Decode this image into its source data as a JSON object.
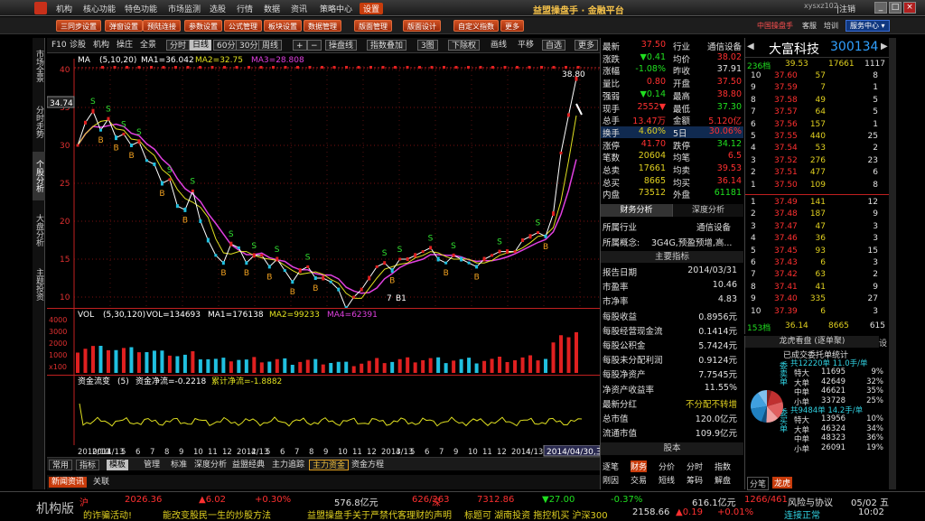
{
  "titlebar": {
    "menus": [
      "机构",
      "核心功能",
      "特色功能",
      "市场监测",
      "选股",
      "行情",
      "数据",
      "资讯",
      "策略中心",
      "设置"
    ],
    "active_menu": "设置",
    "app_title": "益盟操盘手 · 金融平台",
    "user": "xysxz102",
    "exit": "|注销"
  },
  "toolbar2": {
    "buttons": [
      "三同步设置",
      "弹窗设置",
      "预陆连接",
      "参数设置",
      "公式管理",
      "板块设置",
      "数据管理",
      "版面管理",
      "版面设计",
      "自定义指数",
      "更多"
    ],
    "right_links": [
      "中国操盘手",
      "客服",
      "培训"
    ],
    "service_center": "服务中心 ▾"
  },
  "side_tabs": [
    "市场全景",
    "分时走势",
    "个股分析",
    "大盘分析",
    "主题投资"
  ],
  "chart_toolbar": {
    "items": [
      "F10",
      "诊股",
      "机构",
      "操庄",
      "全景",
      "分时",
      "日线",
      "60分",
      "30分",
      "周线",
      "+",
      "−",
      "操盘线",
      "指数叠加",
      "3图",
      "下除权",
      "画线",
      "平移",
      "自选",
      "更多"
    ],
    "selected": "日线"
  },
  "price_chart": {
    "indicator": "MA",
    "params": "(5,10,20)",
    "ma1": "MA1=36.042",
    "ma2": "MA2=32.75",
    "ma3": "MA3=28.808",
    "y_ticks": [
      "40",
      "35",
      "30",
      "25",
      "20",
      "15",
      "10"
    ],
    "marker_high": "38.80",
    "marker_left": "34.74",
    "marker_low": "7",
    "marker_b1": "B1"
  },
  "vol_chart": {
    "title": "VOL",
    "params": "(5,30,120)",
    "vol": "VOL=134693",
    "ma1": "MA1=176138",
    "ma2": "MA2=99233",
    "ma4": "MA4=62391",
    "y_ticks": [
      "4000",
      "3000",
      "2000",
      "1000",
      "x100"
    ]
  },
  "flow_chart": {
    "title": "资金流变",
    "params": "(5)",
    "net": "资金净流=-0.2218",
    "cum": "累计净流=-1.8882"
  },
  "chart_data": {
    "type": "line",
    "xlabel": "",
    "ylabel": "",
    "x_ticks": [
      "2010/10",
      "2011/13",
      "4",
      "5",
      "6",
      "7",
      "8",
      "9",
      "10",
      "11",
      "12",
      "2012/13",
      "4",
      "5",
      "6",
      "7",
      "8",
      "9",
      "10",
      "11",
      "12",
      "2013/13",
      "4",
      "5",
      "6",
      "7",
      "9",
      "10",
      "11",
      "12",
      "2014/13",
      "4"
    ],
    "ylim": [
      10,
      40
    ],
    "series": [
      {
        "values": [
          30,
          33,
          34.5,
          32,
          33.5,
          31,
          31.5,
          30,
          30.5,
          28,
          27.5,
          25,
          25.5,
          22,
          21.5,
          24,
          20,
          17.5,
          15.5,
          14.5,
          17,
          16.5,
          14.5,
          15.5,
          15.5,
          14,
          15,
          13.5,
          12,
          13.5,
          14,
          12.5,
          12.5,
          12,
          11,
          8.5,
          10,
          11,
          12.5,
          14,
          14.5,
          13.5,
          15,
          15,
          15.5,
          16,
          16.5,
          15,
          14.5,
          15.5,
          15,
          14.5,
          14,
          15,
          15.5,
          16,
          16,
          16,
          17.5,
          18,
          18.5,
          18,
          21,
          29,
          34,
          38.8
        ]
      }
    ],
    "current_date": "2014/04/30,三"
  },
  "quote": {
    "rows": [
      [
        "最新",
        "37.50",
        "行业",
        "通信设备"
      ],
      [
        "涨跌",
        "▼0.41",
        "均价",
        "38.02"
      ],
      [
        "涨幅",
        "-1.08%",
        "昨收",
        "37.91"
      ],
      [
        "量比",
        "0.80",
        "开盘",
        "37.50"
      ],
      [
        "强弱",
        "▼0.14",
        "最高",
        "38.80"
      ],
      [
        "现手",
        "2552▼",
        "最低",
        "37.30"
      ],
      [
        "总手",
        "13.47万",
        "金额",
        "5.120亿"
      ],
      [
        "换手",
        "4.60%",
        "5日",
        "30.06%"
      ],
      [
        "涨停",
        "41.70",
        "跌停",
        "34.12"
      ],
      [
        "笔数",
        "20604",
        "均笔",
        "6.5"
      ],
      [
        "总卖",
        "17661",
        "均卖",
        "39.53"
      ],
      [
        "总买",
        "8665",
        "均买",
        "36.14"
      ],
      [
        "内盘",
        "73512",
        "外盘",
        "61181"
      ]
    ]
  },
  "fin": {
    "tabs": [
      "财务分析",
      "深度分析"
    ],
    "industry_label": "所属行业",
    "industry": "通信设备",
    "concept_label": "所属概念:",
    "concept": "3G4G,预盈预增,高...",
    "main_title": "主要指标",
    "rows": [
      [
        "报告日期",
        "2014/03/31"
      ],
      [
        "市盈率",
        "10.46"
      ],
      [
        "市净率",
        "4.83"
      ],
      [
        "每股收益",
        "0.8956元"
      ],
      [
        "每股经营现金流",
        "0.1414元"
      ],
      [
        "每股公积金",
        "5.7424元"
      ],
      [
        "每股未分配利润",
        "0.9124元"
      ],
      [
        "每股净资产",
        "7.7545元"
      ],
      [
        "净资产收益率",
        "11.55%"
      ],
      [
        "最新分红",
        "不分配不转增"
      ],
      [
        "总市值",
        "120.0亿元"
      ],
      [
        "流通市值",
        "109.9亿元"
      ]
    ],
    "shares_title": "股本",
    "bottom_tabs": [
      "逐笔",
      "财务",
      "分价",
      "分时",
      "指数",
      "刚因",
      "交易",
      "短线",
      "筹码",
      "解盘"
    ]
  },
  "depth": {
    "name": "大富科技",
    "code": "300134",
    "header": [
      "236档",
      "39.53",
      "17661",
      "1117"
    ],
    "sells": [
      [
        "10",
        "37.60",
        "57",
        "8"
      ],
      [
        "9",
        "37.59",
        "7",
        "1"
      ],
      [
        "8",
        "37.58",
        "49",
        "5"
      ],
      [
        "7",
        "37.57",
        "64",
        "5"
      ],
      [
        "6",
        "37.56",
        "157",
        "1"
      ],
      [
        "5",
        "37.55",
        "440",
        "25"
      ],
      [
        "4",
        "37.54",
        "53",
        "2"
      ],
      [
        "3",
        "37.52",
        "276",
        "23"
      ],
      [
        "2",
        "37.51",
        "477",
        "6"
      ],
      [
        "1",
        "37.50",
        "109",
        "8"
      ]
    ],
    "buys": [
      [
        "1",
        "37.49",
        "141",
        "12"
      ],
      [
        "2",
        "37.48",
        "187",
        "9"
      ],
      [
        "3",
        "37.47",
        "47",
        "3"
      ],
      [
        "4",
        "37.46",
        "36",
        "3"
      ],
      [
        "5",
        "37.45",
        "93",
        "15"
      ],
      [
        "6",
        "37.43",
        "6",
        "3"
      ],
      [
        "7",
        "37.42",
        "63",
        "2"
      ],
      [
        "8",
        "37.41",
        "41",
        "9"
      ],
      [
        "9",
        "37.40",
        "335",
        "27"
      ],
      [
        "10",
        "37.39",
        "6",
        "3"
      ]
    ],
    "footer": [
      "153档",
      "36.14",
      "8665",
      "615"
    ]
  },
  "dragon": {
    "title": "龙虎看盘 (逐单聚)",
    "setting": "设",
    "subtitle": "已成交委托单统计",
    "sell_total": "共12220单 11.0手/单",
    "sell_rows": [
      [
        "特大",
        "11695",
        "9%"
      ],
      [
        "大单",
        "42649",
        "32%"
      ],
      [
        "中单",
        "46621",
        "35%"
      ],
      [
        "小单",
        "33728",
        "25%"
      ]
    ],
    "buy_total": "共9484单 14.2手/单",
    "buy_rows": [
      [
        "特大",
        "13956",
        "10%"
      ],
      [
        "大单",
        "46324",
        "34%"
      ],
      [
        "中单",
        "48323",
        "36%"
      ],
      [
        "小单",
        "26091",
        "19%"
      ]
    ],
    "sell_label": "委卖单",
    "buy_label": "委买单",
    "tabs": [
      "分笔",
      "龙虎"
    ]
  },
  "bottom_tabs": {
    "left": [
      "常用",
      "指标",
      "模板"
    ],
    "items": [
      "管理",
      "标准",
      "深度分析",
      "益盟经典",
      "主力追踪",
      "主力资金",
      "资金方程"
    ],
    "active": "主力资金"
  },
  "news_tabs": [
    "新闻资讯",
    "关联"
  ],
  "ticker": {
    "line1": [
      [
        "沪",
        "red"
      ],
      [
        "2026.36",
        "red"
      ],
      [
        "▲6.02",
        "red"
      ],
      [
        "+0.30%",
        "red"
      ],
      [
        "576.8亿元",
        "white"
      ],
      [
        "626/263",
        "red"
      ],
      [
        "深",
        "red"
      ],
      [
        "7312.86",
        "red"
      ],
      [
        "▼27.00",
        "green"
      ],
      [
        "-0.37%",
        "green"
      ],
      [
        "616.1亿元",
        "white"
      ],
      [
        "1266/461",
        "red"
      ],
      [
        "风险与协议",
        "white"
      ],
      [
        "05/02 五",
        "white"
      ]
    ],
    "line2": [
      "的诈骗活动!",
      "能改变股民一生的炒股方法",
      "益盟操盘手关于严禁代客理财的声明",
      "标题可 湖南投资 拖控机买 沪深300",
      "2158.66",
      "▲0.19",
      "+0.01%",
      "连接正常",
      "10:02"
    ],
    "brand": "机构版"
  }
}
